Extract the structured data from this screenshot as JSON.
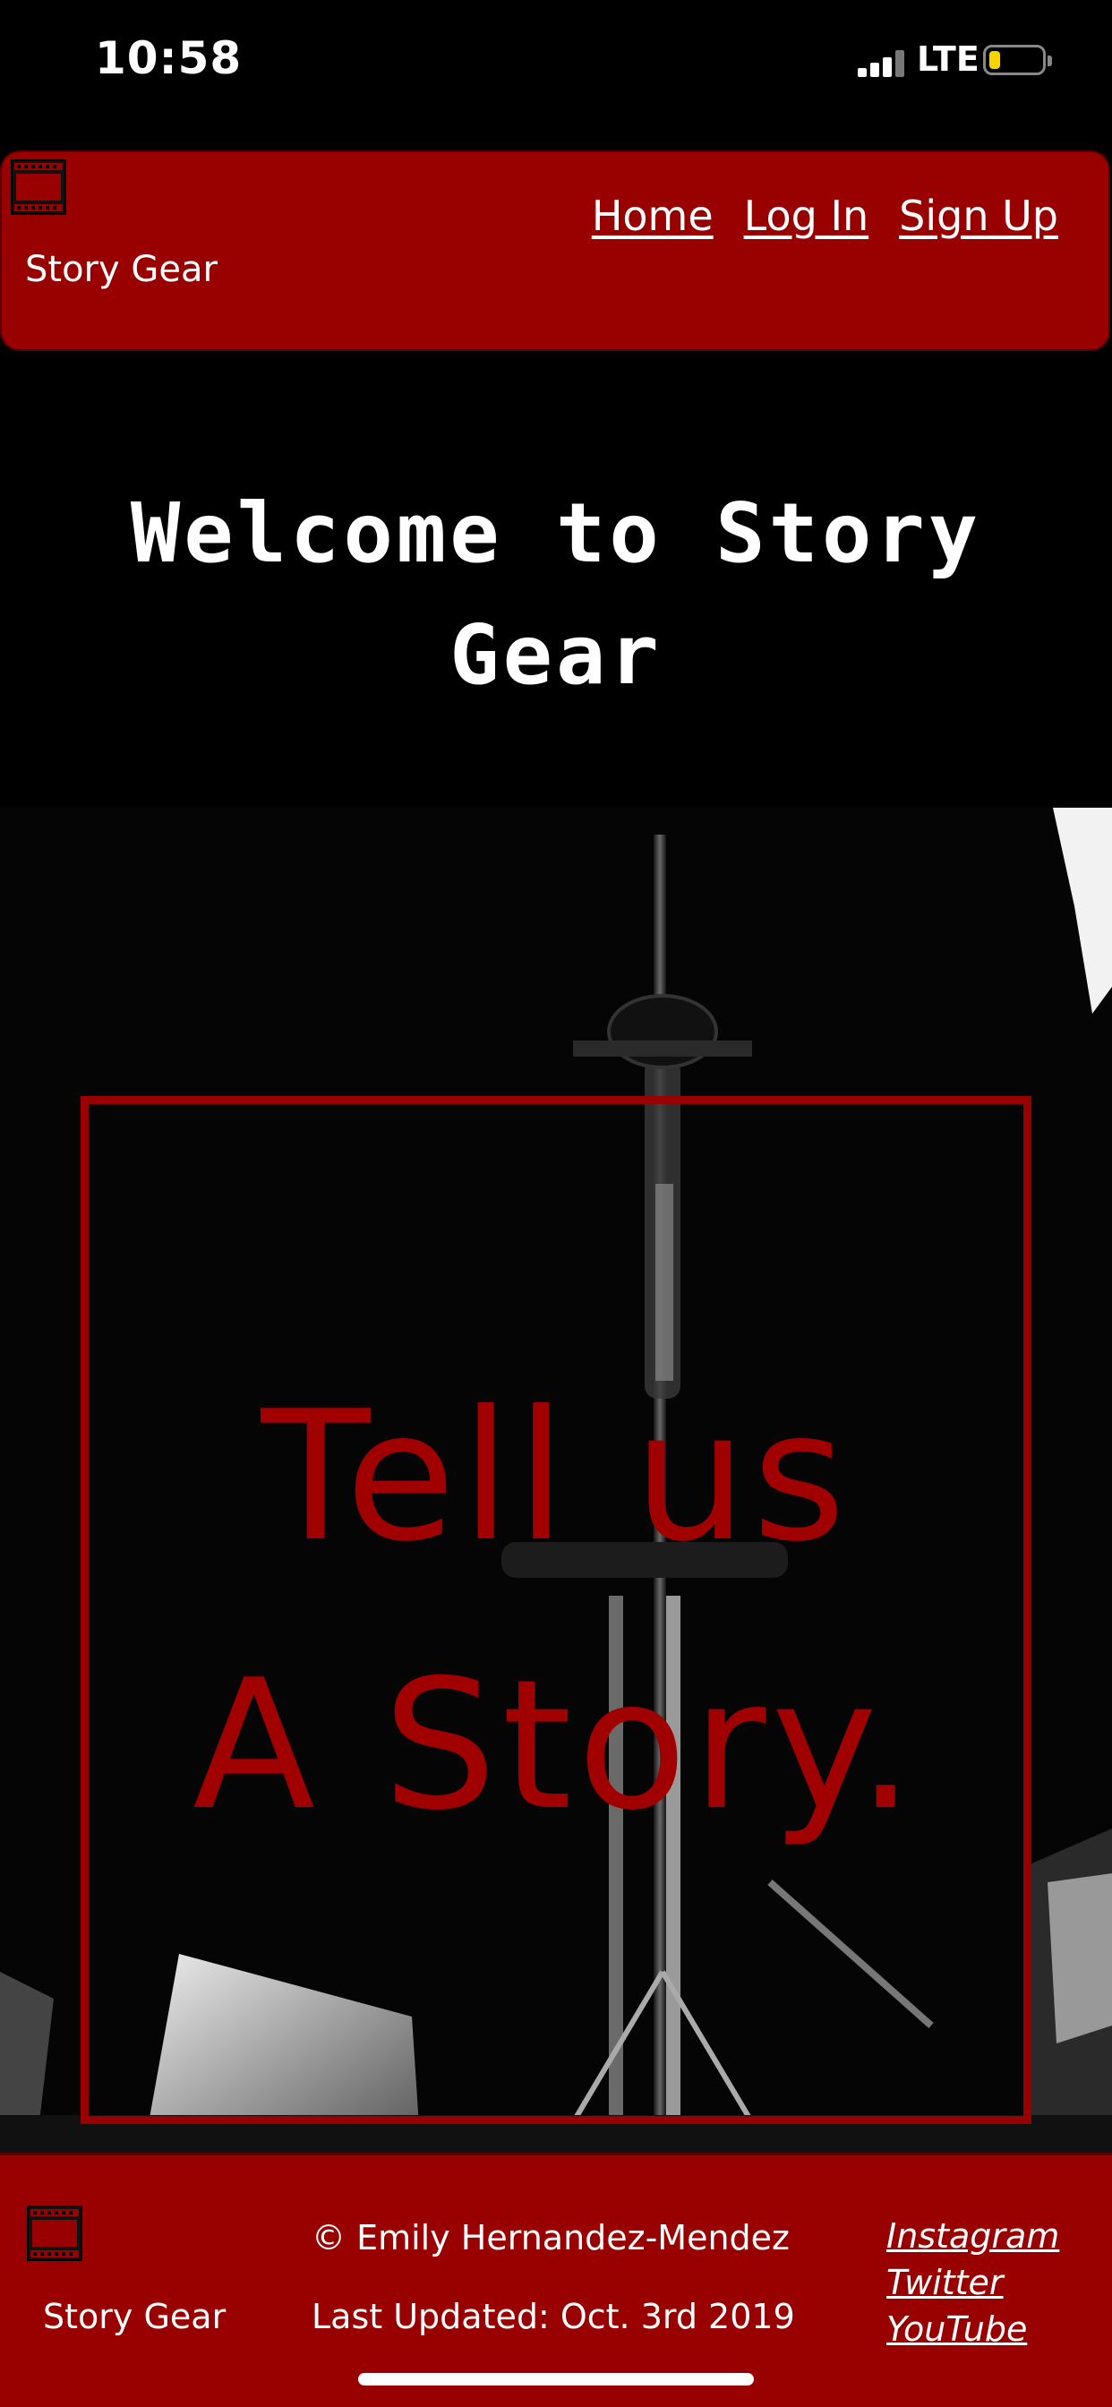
{
  "status_bar": {
    "time": "10:58",
    "network": "LTE",
    "battery_level": 0.15,
    "battery_color": "#f5d400"
  },
  "header": {
    "logo_icon": "film-strip-icon",
    "brand": "Story Gear",
    "nav": {
      "home": "Home",
      "login": "Log In",
      "signup": "Sign Up"
    }
  },
  "main": {
    "welcome_title": "Welcome to Story Gear",
    "hero_tagline_line1": "Tell us",
    "hero_tagline_line2": "A Story."
  },
  "footer": {
    "logo_icon": "film-strip-icon",
    "brand": "Story Gear",
    "copyright": "© Emily Hernandez-Mendez",
    "last_updated": "Last Updated: Oct. 3rd 2019",
    "social": {
      "instagram": "Instagram",
      "twitter": "Twitter",
      "youtube": "YouTube"
    }
  },
  "colors": {
    "accent": "#990000",
    "background": "#000000",
    "text": "#ffffff"
  }
}
